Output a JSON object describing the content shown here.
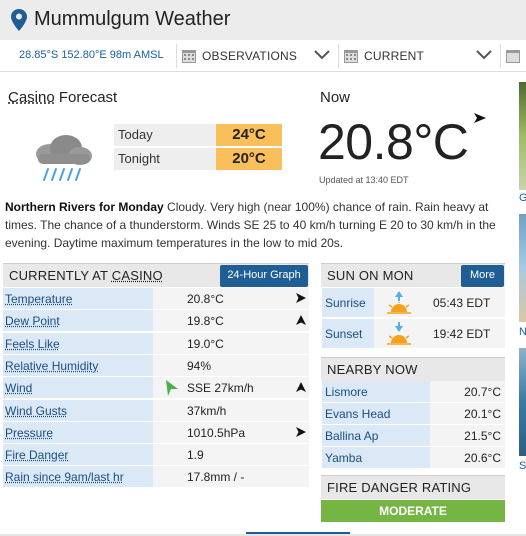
{
  "header": {
    "title": "Mummulgum Weather"
  },
  "location_bar": {
    "coords": "28.85°S 152.80°E 98m AMSL",
    "selectors": [
      {
        "label": "OBSERVATIONS"
      },
      {
        "label": "CURRENT"
      }
    ]
  },
  "forecast": {
    "place": "Casino",
    "heading_suffix": " Forecast",
    "icon": "cloud-rain-icon",
    "rows": [
      {
        "label": "Today",
        "value": "24°C"
      },
      {
        "label": "Tonight",
        "value": "20°C"
      }
    ]
  },
  "now": {
    "label": "Now",
    "temperature": "20.8°C",
    "updated": "Updated at 13:40 EDT"
  },
  "district": {
    "name": "Northern Rivers for Monday",
    "text": " Cloudy. Very high (near 100%) chance of rain. Rain heavy at times. The chance of a thunderstorm. Winds SE 25 to 40 km/h turning E 20 to 30 km/h in the evening. Daytime maximum temperatures in the low to mid 20s."
  },
  "current": {
    "title_prefix": "CURRENTLY AT ",
    "title_place": "CASINO",
    "graph_button": "24-Hour Graph",
    "rows": [
      {
        "label": "Temperature",
        "value": "20.8°C",
        "trend": "right"
      },
      {
        "label": "Dew Point",
        "value": "19.8°C",
        "trend": "up"
      },
      {
        "label": "Feels Like",
        "value": "19.0°C",
        "trend": ""
      },
      {
        "label": "Relative Humidity",
        "value": "94%",
        "trend": ""
      },
      {
        "label": "Wind",
        "value": "SSE 27km/h",
        "trend": "up"
      },
      {
        "label": "Wind Gusts",
        "value": "37km/h",
        "trend": ""
      },
      {
        "label": "Pressure",
        "value": "1010.5hPa",
        "trend": "right"
      },
      {
        "label": "Fire Danger",
        "value": "1.9",
        "trend": ""
      },
      {
        "label": "Rain since 9am/last hr",
        "value": "17.8mm / -",
        "trend": ""
      }
    ]
  },
  "sun": {
    "title": "SUN ON MON",
    "more_button": "More",
    "rows": [
      {
        "label": "Sunrise",
        "value": "05:43 EDT",
        "icon": "sunrise-icon"
      },
      {
        "label": "Sunset",
        "value": "19:42 EDT",
        "icon": "sunset-icon"
      }
    ]
  },
  "nearby": {
    "title": "NEARBY NOW",
    "rows": [
      {
        "label": "Lismore",
        "value": "20.7°C"
      },
      {
        "label": "Evans Head",
        "value": "20.1°C"
      },
      {
        "label": "Ballina Ap",
        "value": "21.5°C"
      },
      {
        "label": "Yamba",
        "value": "20.6°C"
      }
    ]
  },
  "fire": {
    "title": "FIRE DANGER RATING",
    "rating": "MODERATE"
  },
  "side_strip": {
    "letters": [
      "G",
      "N",
      "S"
    ]
  },
  "colors": {
    "accent_blue": "#1e5e94",
    "forecast_orange": "#f9bf5b",
    "fire_green": "#74b543"
  }
}
